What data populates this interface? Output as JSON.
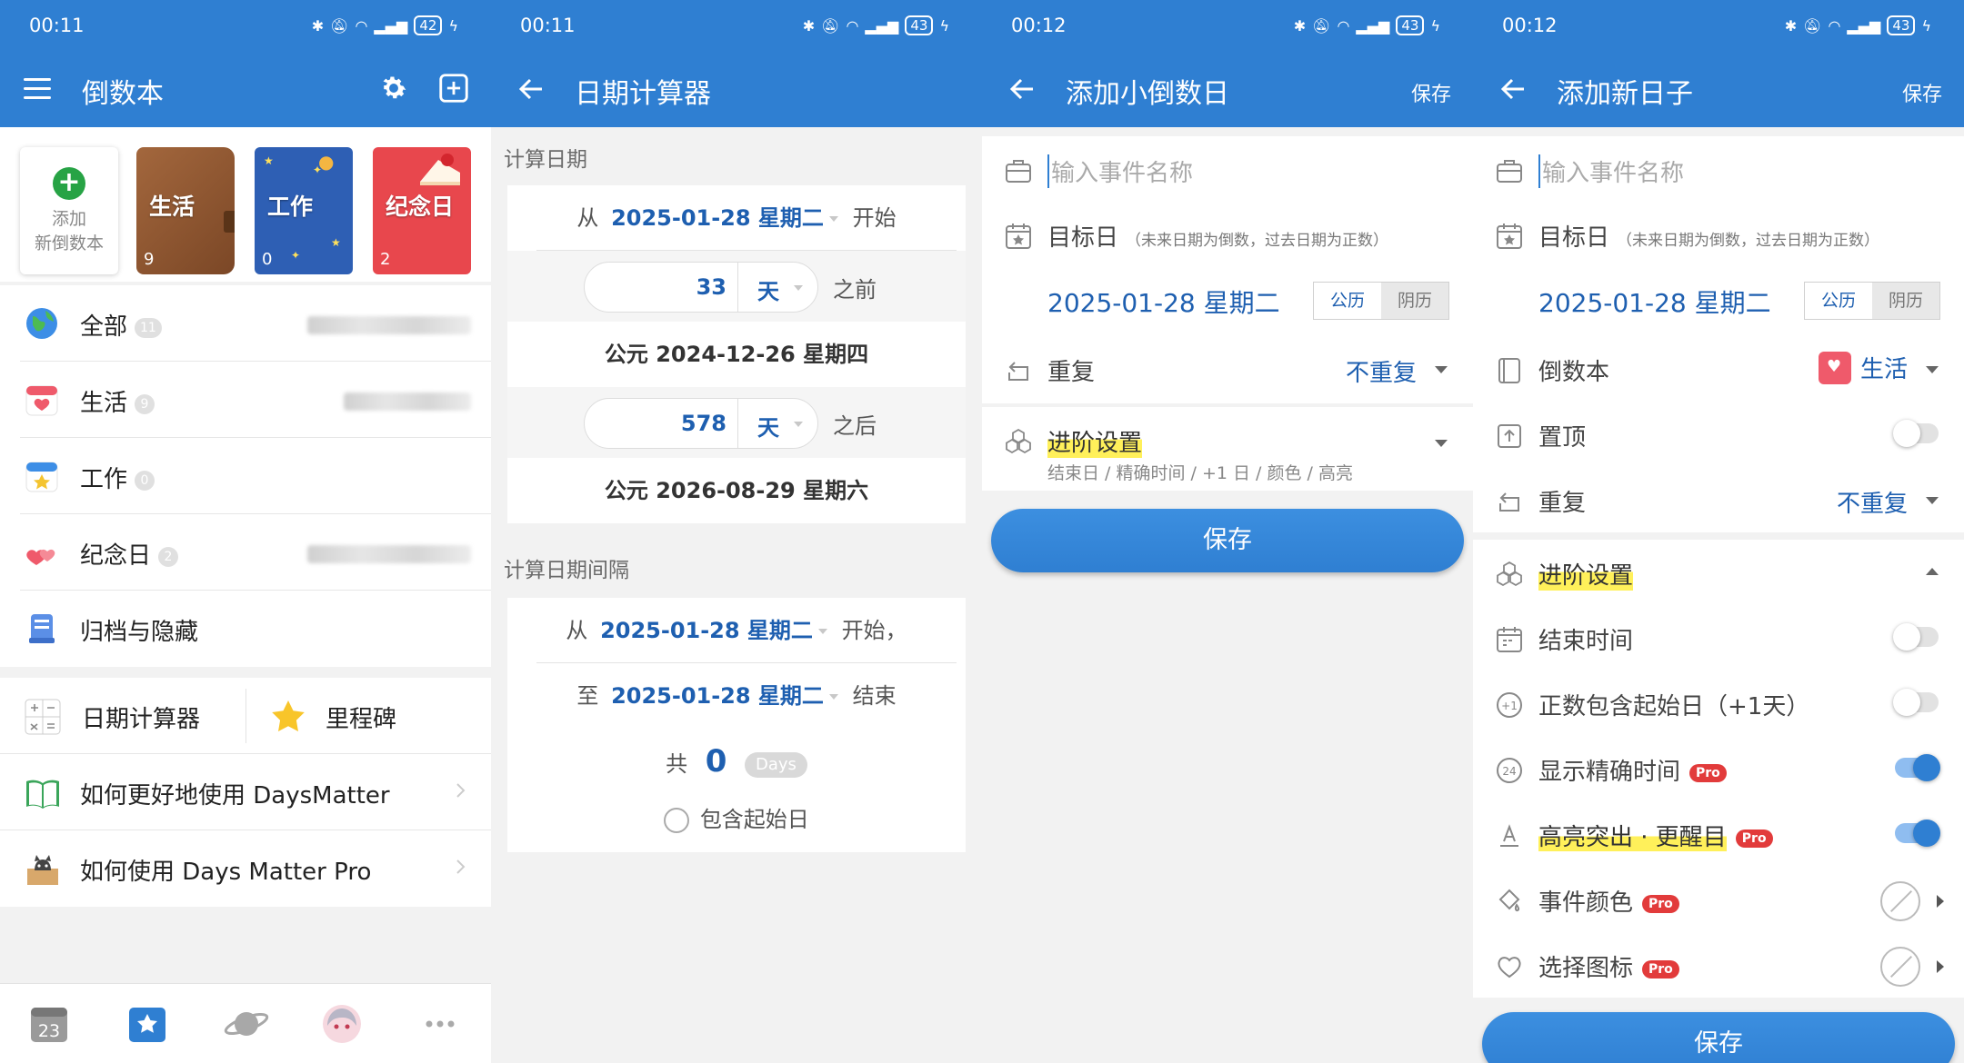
{
  "status_bars": [
    {
      "time": "00:11",
      "battery": "42"
    },
    {
      "time": "00:11",
      "battery": "43"
    },
    {
      "time": "00:12",
      "battery": "43"
    },
    {
      "time": "00:12",
      "battery": "43"
    }
  ],
  "screen1": {
    "title": "倒数本",
    "add_notebook": [
      "添加",
      "新倒数本"
    ],
    "notebooks": [
      {
        "label": "生活",
        "count": "9"
      },
      {
        "label": "工作",
        "count": "0"
      },
      {
        "label": "纪念日",
        "count": "2"
      }
    ],
    "categories": [
      {
        "label": "全部",
        "count": "11"
      },
      {
        "label": "生活",
        "count": "9"
      },
      {
        "label": "工作",
        "count": "0"
      },
      {
        "label": "纪念日",
        "count": "2"
      },
      {
        "label": "归档与隐藏",
        "count": ""
      }
    ],
    "tools": {
      "date_calc": "日期计算器",
      "milestone": "里程碑"
    },
    "guides": [
      "如何更好地使用 DaysMatter",
      "如何使用 Days Matter Pro"
    ],
    "bottom_nav": {
      "calendar_day": "23"
    }
  },
  "screen2": {
    "title": "日期计算器",
    "section1": "计算日期",
    "from_prefix": "从",
    "from_date": "2025-01-28 星期二",
    "from_suffix": "开始",
    "before_value": "33",
    "before_unit": "天",
    "before_suffix": "之前",
    "before_result": "公元 2024-12-26 星期四",
    "after_value": "578",
    "after_unit": "天",
    "after_suffix": "之后",
    "after_result": "公元 2026-08-29 星期六",
    "section2": "计算日期间隔",
    "interval_from_prefix": "从",
    "interval_from": "2025-01-28 星期二",
    "interval_from_suffix": "开始，",
    "interval_to_prefix": "至",
    "interval_to": "2025-01-28 星期二",
    "interval_to_suffix": "结束",
    "total_prefix": "共",
    "total_value": "0",
    "total_unit": "Days",
    "include_start": "包含起始日"
  },
  "screen3": {
    "title": "添加小倒数日",
    "save_action": "保存",
    "name_placeholder": "输入事件名称",
    "target_label": "目标日",
    "target_hint": "（未来日期为倒数，过去日期为正数）",
    "date": "2025-01-28 星期二",
    "cal_solar": "公历",
    "cal_lunar": "阴历",
    "repeat_label": "重复",
    "repeat_value": "不重复",
    "advanced_label": "进阶设置",
    "advanced_sub": "结束日 / 精确时间 / +1 日 / 颜色 / 高亮",
    "save_button": "保存"
  },
  "screen4": {
    "title": "添加新日子",
    "save_action": "保存",
    "name_placeholder": "输入事件名称",
    "target_label": "目标日",
    "target_hint": "（未来日期为倒数，过去日期为正数）",
    "date": "2025-01-28 星期二",
    "cal_solar": "公历",
    "cal_lunar": "阴历",
    "notebook_label": "倒数本",
    "notebook_value": "生活",
    "pin_label": "置顶",
    "repeat_label": "重复",
    "repeat_value": "不重复",
    "advanced_label": "进阶设置",
    "end_time": "结束时间",
    "include_start": "正数包含起始日（+1天）",
    "exact_time": "显示精确时间",
    "highlight": "高亮突出 · 更醒目",
    "event_color": "事件颜色",
    "choose_icon": "选择图标",
    "pro_badge": "Pro",
    "save_button": "保存"
  },
  "colors": {
    "primary": "#2f7fd2",
    "accent_text": "#1e5fb0",
    "pro": "#e23b3b",
    "highlight": "#fff05a"
  }
}
